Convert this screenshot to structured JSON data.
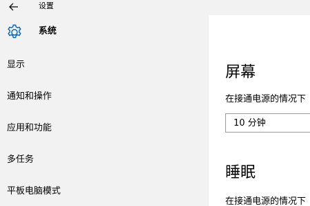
{
  "titlebar": {
    "title": "设置"
  },
  "sidebar": {
    "section_title": "系统",
    "items": [
      {
        "label": "显示"
      },
      {
        "label": "通知和操作"
      },
      {
        "label": "应用和功能"
      },
      {
        "label": "多任务"
      },
      {
        "label": "平板电脑模式"
      }
    ]
  },
  "content": {
    "screen_heading": "屏幕",
    "screen_desc": "在接通电源的情况下",
    "screen_select_value": "10 分钟",
    "sleep_heading": "睡眠",
    "sleep_desc": "在接通电源的情况下"
  },
  "icons": {
    "back": "back-arrow-icon",
    "section": "gear-icon"
  },
  "colors": {
    "sidebar_bg": "#f2f2f2",
    "accent": "#0063b1",
    "content_bg": "#ffffff"
  }
}
